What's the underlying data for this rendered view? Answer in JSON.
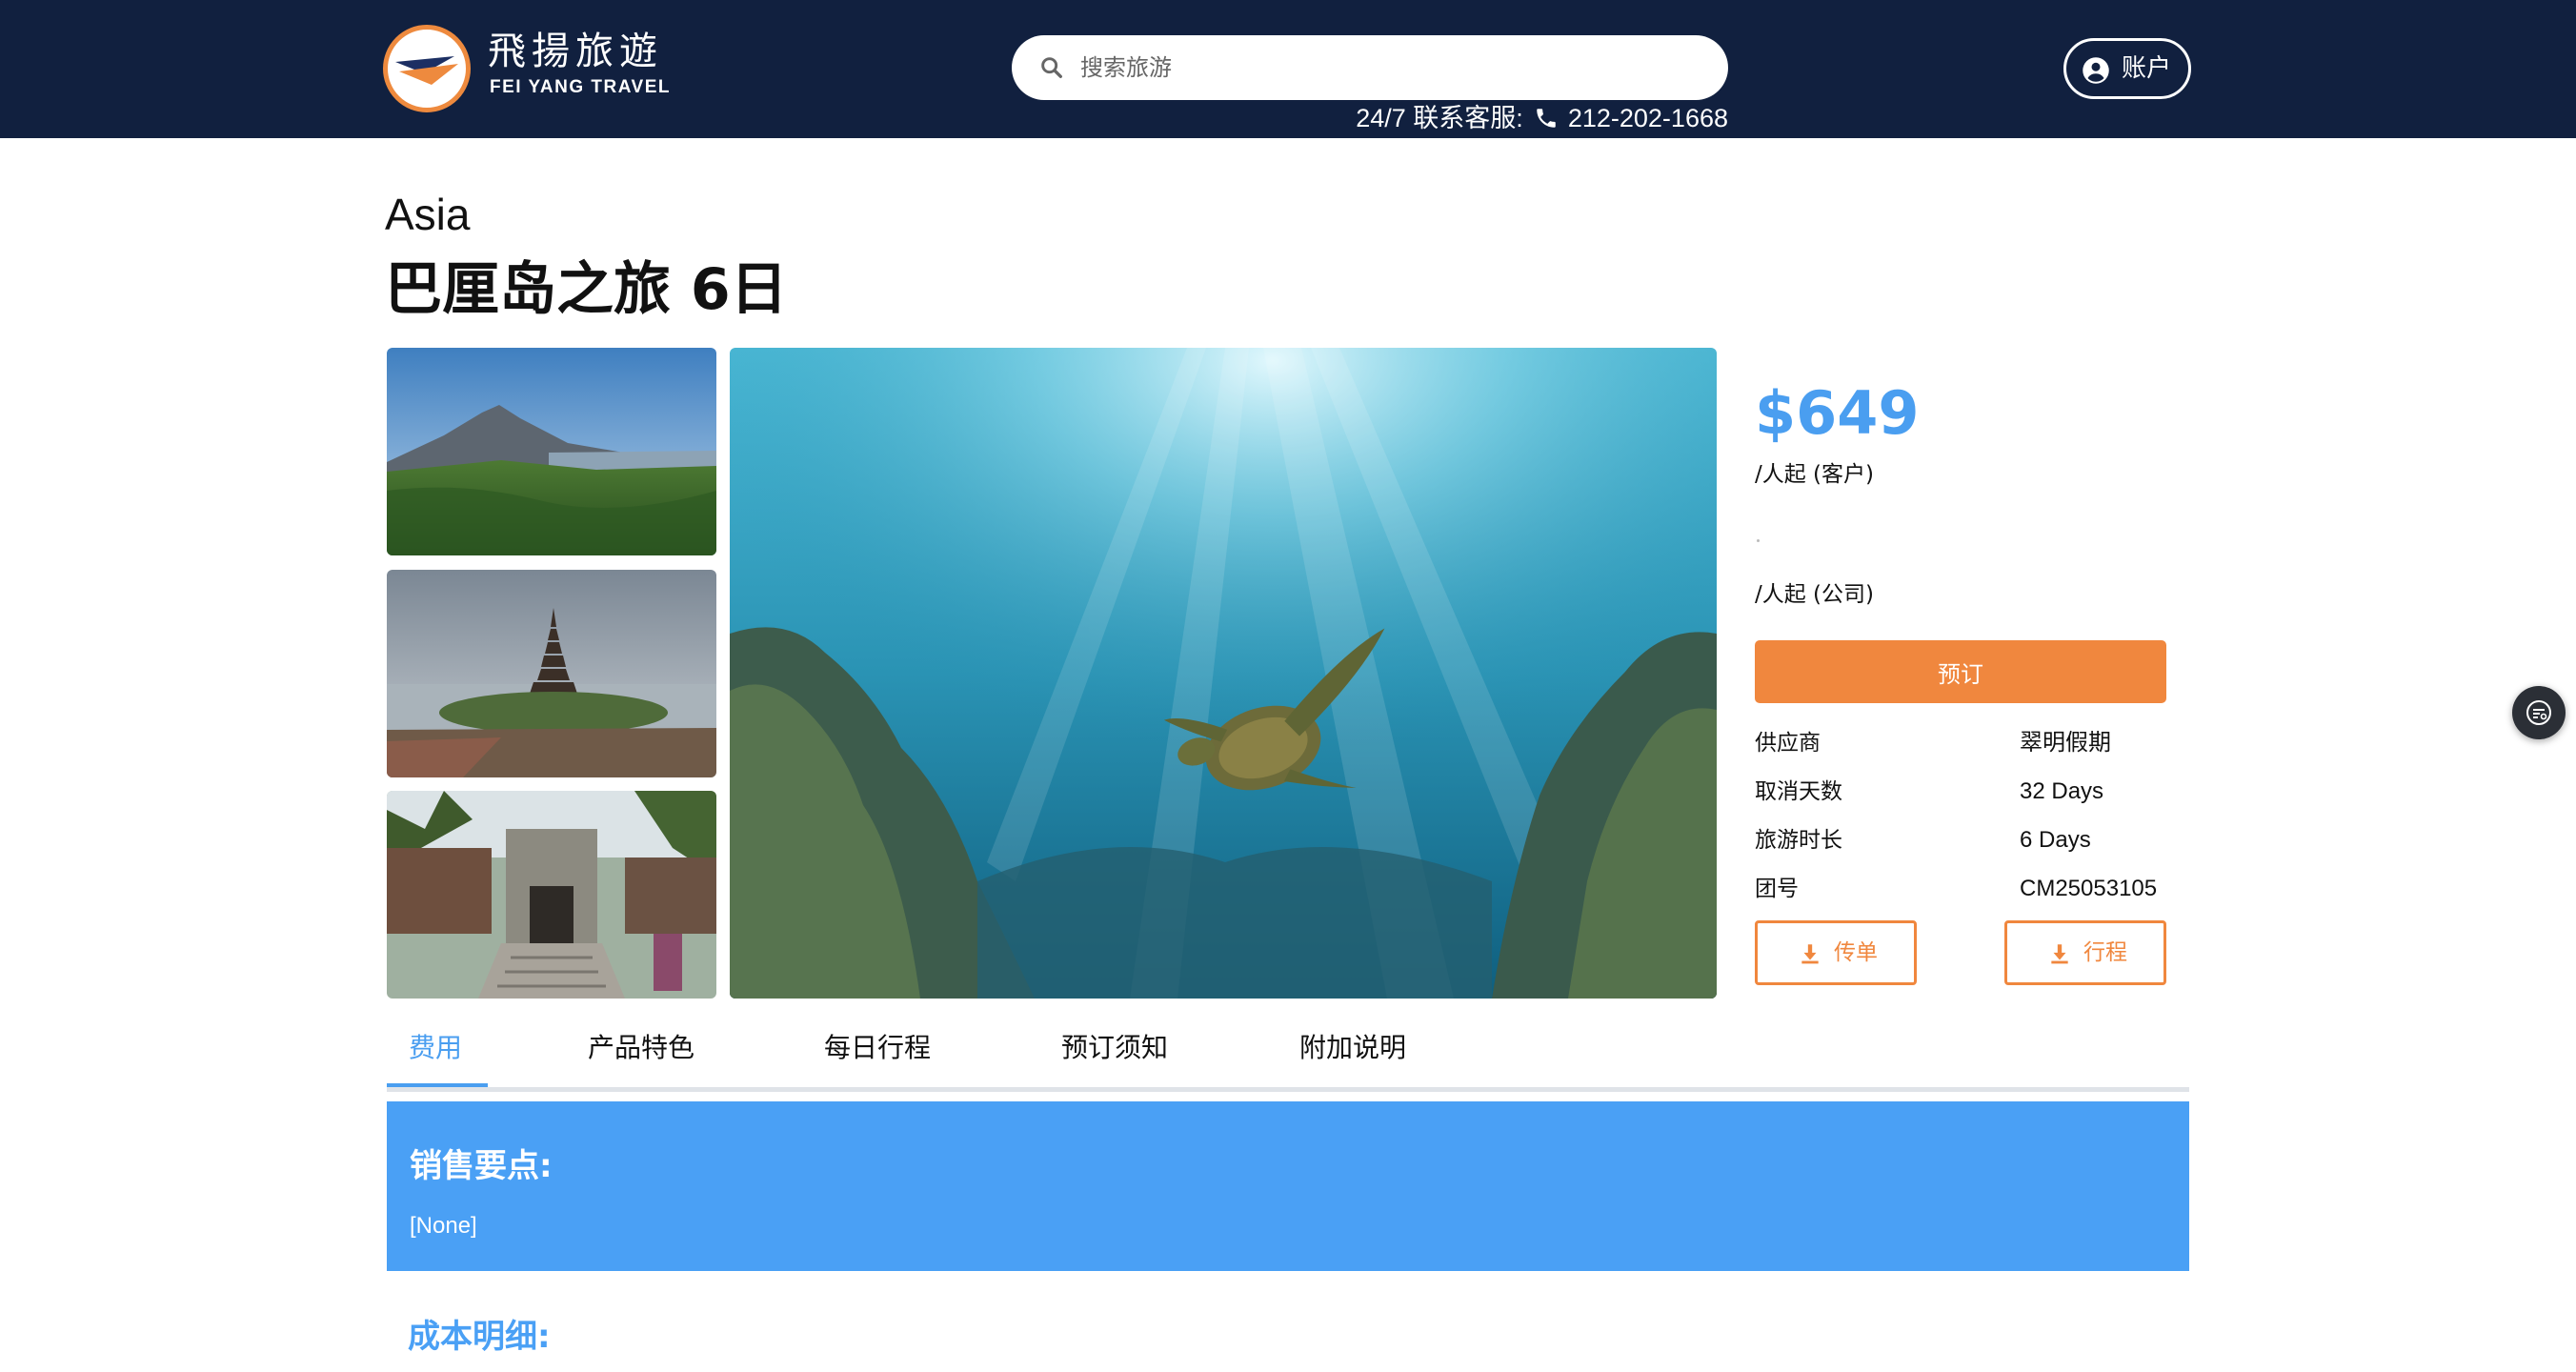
{
  "brand": {
    "name_cn": "飛揚旅遊",
    "name_en": "FEI YANG TRAVEL",
    "colors": {
      "navy": "#11203f",
      "orange": "#f0873e",
      "blue": "#4a9ef0"
    }
  },
  "header": {
    "search_placeholder": "搜索旅游",
    "hotline_label": "24/7 联系客服:",
    "hotline_number": "212-202-1668",
    "account_label": "账户",
    "icons": {
      "search": "search-icon",
      "phone": "phone-icon",
      "account": "account-circle-icon"
    }
  },
  "product": {
    "region": "Asia",
    "title": "巴厘岛之旅 6日",
    "images": [
      "volcano-landscape",
      "water-temple-pagoda",
      "stone-temple-gate",
      "sea-turtle-underwater"
    ]
  },
  "pricing": {
    "price": "$649",
    "per_customer": "/人起 (客户)",
    "per_company": "/人起 (公司)",
    "book_label": "预订",
    "info": [
      {
        "label": "供应商",
        "value": "翠明假期"
      },
      {
        "label": "取消天数",
        "value": "32 Days"
      },
      {
        "label": "旅游时长",
        "value": "6 Days"
      },
      {
        "label": "团号",
        "value": "CM25053105"
      }
    ],
    "flyer_label": "传单",
    "itinerary_label": "行程"
  },
  "tabs": [
    {
      "label": "费用",
      "active": true
    },
    {
      "label": "产品特色",
      "active": false
    },
    {
      "label": "每日行程",
      "active": false
    },
    {
      "label": "预订须知",
      "active": false
    },
    {
      "label": "附加说明",
      "active": false
    }
  ],
  "content": {
    "sales_title": "销售要点:",
    "sales_text": "[None]",
    "cost_title": "成本明细:"
  }
}
